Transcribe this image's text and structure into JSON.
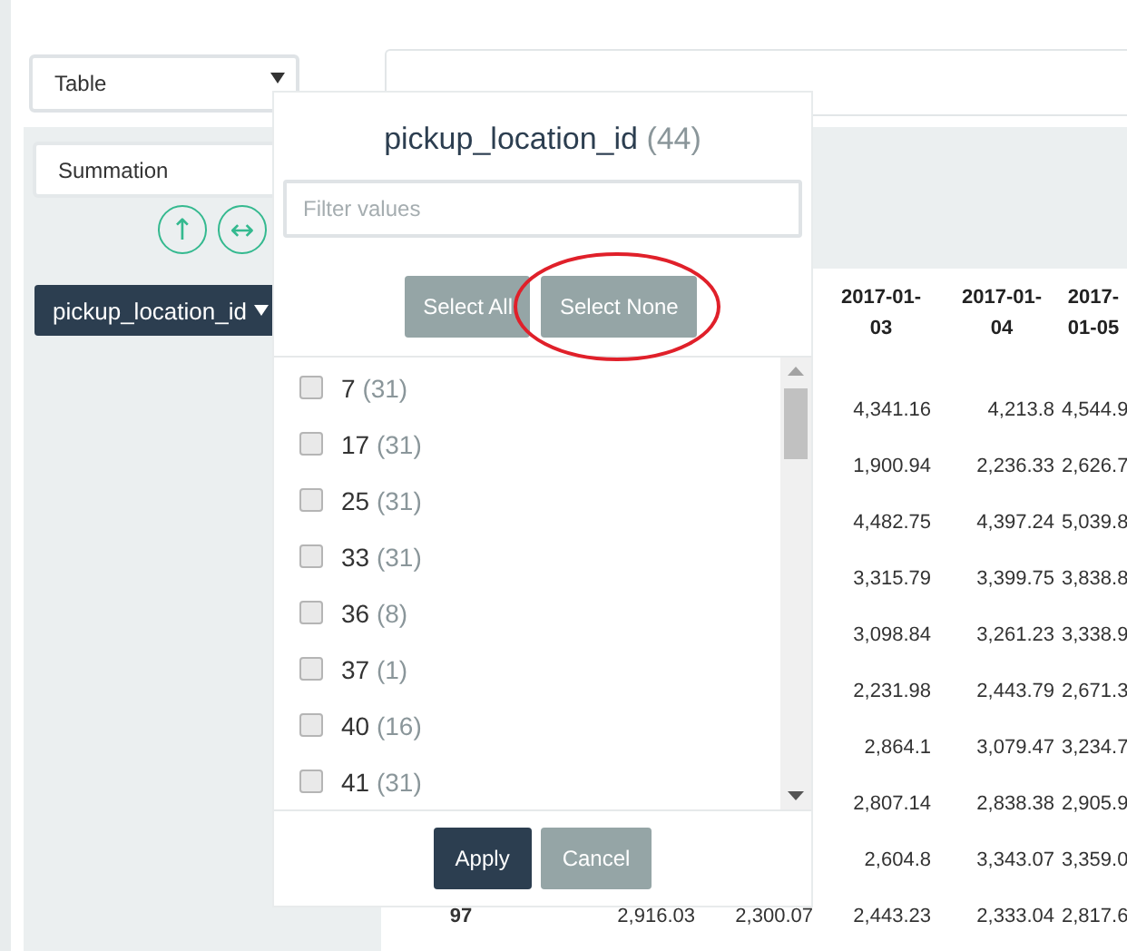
{
  "renderer_select": {
    "value": "Table"
  },
  "aggregator_select": {
    "value": "Summation"
  },
  "sort_buttons": [
    {
      "symbol": "↑"
    },
    {
      "symbol": "↔"
    }
  ],
  "row_attribute": {
    "label": "pickup_location_id"
  },
  "table": {
    "columns": [
      {
        "label": "2017-01-03"
      },
      {
        "label": "2017-01-04"
      },
      {
        "label": "2017-01-05"
      }
    ],
    "rows": [
      {
        "cells": [
          "4,341.16",
          "4,213.8",
          "4,544.9"
        ]
      },
      {
        "cells": [
          "1,900.94",
          "2,236.33",
          "2,626.7"
        ]
      },
      {
        "cells": [
          "4,482.75",
          "4,397.24",
          "5,039.8"
        ]
      },
      {
        "cells": [
          "3,315.79",
          "3,399.75",
          "3,838.8"
        ]
      },
      {
        "cells": [
          "3,098.84",
          "3,261.23",
          "3,338.9"
        ]
      },
      {
        "cells": [
          "2,231.98",
          "2,443.79",
          "2,671.3"
        ]
      },
      {
        "cells": [
          "2,864.1",
          "3,079.47",
          "3,234.7"
        ]
      },
      {
        "cells": [
          "2,807.14",
          "2,838.38",
          "2,905.9"
        ]
      },
      {
        "cells": [
          "2,604.8",
          "3,343.07",
          "3,359.0"
        ]
      },
      {
        "cells": [
          "97",
          "2,916.03",
          "2,300.07",
          "2,443.23",
          "2,333.04",
          "2,817.6"
        ]
      }
    ]
  },
  "filter_popup": {
    "title": "pickup_location_id",
    "count": "(44)",
    "filter": {
      "placeholder": "Filter values"
    },
    "buttons": [
      {
        "label": "Select All",
        "highlighted": false
      },
      {
        "label": "Select None",
        "highlighted": true
      }
    ],
    "items": [
      {
        "value": "7",
        "count": "(31)",
        "checked": false
      },
      {
        "value": "17",
        "count": "(31)",
        "checked": false
      },
      {
        "value": "25",
        "count": "(31)",
        "checked": false
      },
      {
        "value": "33",
        "count": "(31)",
        "checked": false
      },
      {
        "value": "36",
        "count": "(8)",
        "checked": false
      },
      {
        "value": "37",
        "count": "(1)",
        "checked": false
      },
      {
        "value": "40",
        "count": "(16)",
        "checked": false
      },
      {
        "value": "41",
        "count": "(31)",
        "checked": false
      }
    ],
    "footer_buttons": [
      {
        "label": "Apply",
        "kind": "primary"
      },
      {
        "label": "Cancel",
        "kind": "secondary"
      }
    ]
  }
}
